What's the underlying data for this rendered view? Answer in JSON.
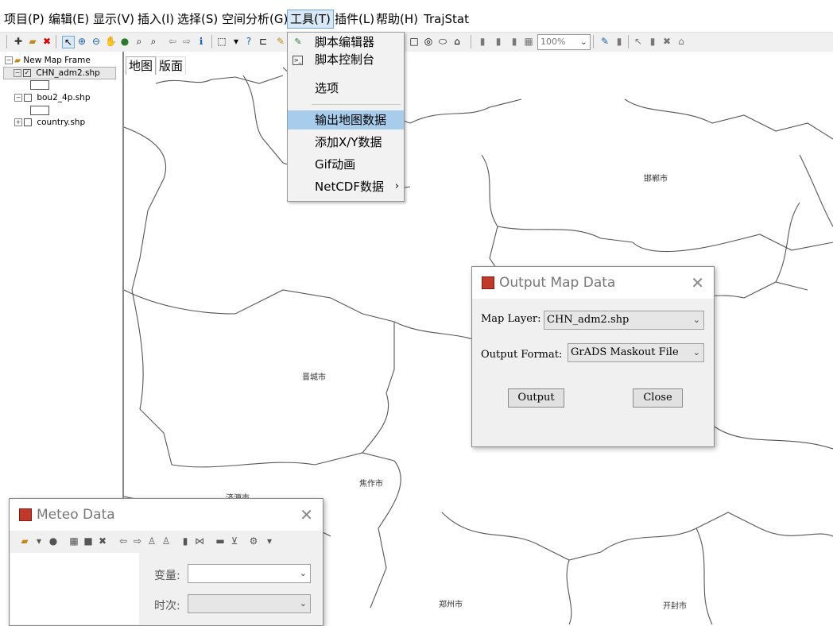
{
  "menubar": {
    "items": [
      "项目(P)",
      "编辑(E)",
      "显示(V)",
      "插入(I)",
      "选择(S)",
      "空间分析(G)",
      "工具(T)",
      "插件(L)",
      "帮助(H)",
      "TrajStat"
    ]
  },
  "toolbar": {
    "zoom_value": "100%"
  },
  "layers": {
    "frame": "New Map Frame",
    "items": [
      "CHN_adm2.shp",
      "bou2_4p.shp",
      "country.shp"
    ]
  },
  "map_tabs": [
    "地图",
    "版面"
  ],
  "cities": [
    "邯郸市",
    "晋城市",
    "焦作市",
    "济源市",
    "郑州市",
    "开封市"
  ],
  "tools_menu": {
    "items": [
      "脚本编辑器",
      "脚本控制台",
      "选项",
      "输出地图数据",
      "添加X/Y数据",
      "Gif动画",
      "NetCDF数据"
    ]
  },
  "output_dialog": {
    "title": "Output Map Data",
    "map_layer_label": "Map Layer:",
    "map_layer_value": "CHN_adm2.shp",
    "output_format_label": "Output Format:",
    "output_format_value": "GrADS Maskout File",
    "output_button": "Output",
    "close_button": "Close"
  },
  "meteo_dialog": {
    "title": "Meteo Data",
    "variable_label": "变量:",
    "time_label": "时次:"
  },
  "colors": {
    "highlight": "#a8cdec",
    "border": "#8a8a8a",
    "map_line": "#555555"
  }
}
